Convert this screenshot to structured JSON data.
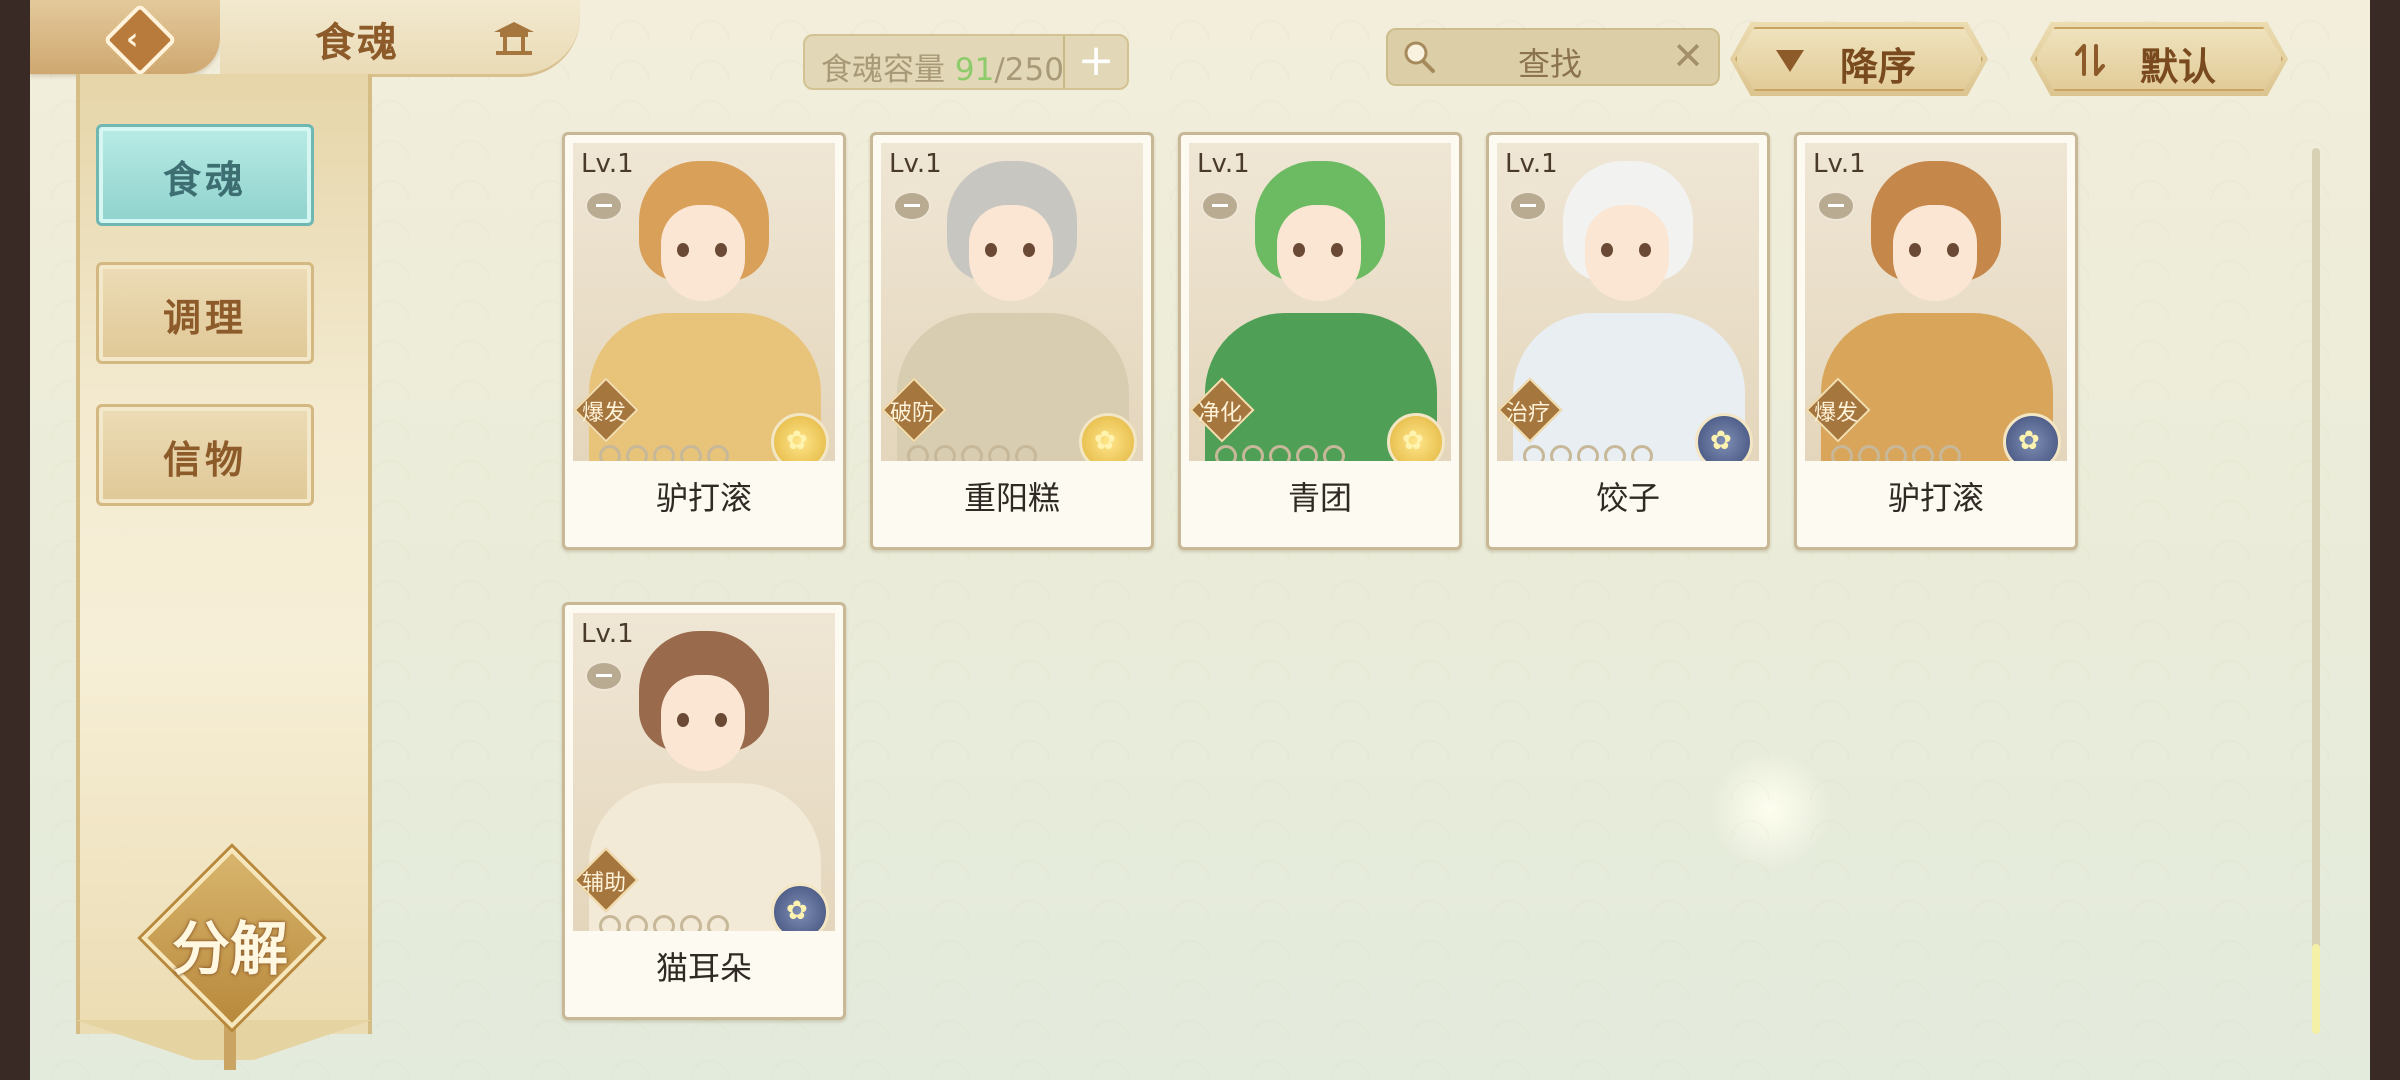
{
  "header": {
    "title": "食魂"
  },
  "capacity": {
    "label": "食魂容量",
    "current": "91",
    "max": "/250",
    "add_label": "+"
  },
  "search": {
    "placeholder": "查找",
    "clear_label": "✕"
  },
  "sort": {
    "order_label": "降序",
    "default_label": "默认"
  },
  "nav": {
    "items": [
      {
        "label": "食魂",
        "active": true
      },
      {
        "label": "调理",
        "active": false
      },
      {
        "label": "信物",
        "active": false
      }
    ],
    "decompose_label": "分解"
  },
  "cards": [
    {
      "level": "Lv.1",
      "name": "驴打滚",
      "skill": "爆发",
      "stars": 0,
      "star_total": 5,
      "rarity": "gold",
      "theme": {
        "hair": "#d9a05a",
        "body": "#e8c37a"
      }
    },
    {
      "level": "Lv.1",
      "name": "重阳糕",
      "skill": "破防",
      "stars": 0,
      "star_total": 5,
      "rarity": "gold",
      "theme": {
        "hair": "#c8c6c0",
        "body": "#d8cdb0"
      }
    },
    {
      "level": "Lv.1",
      "name": "青团",
      "skill": "净化",
      "stars": 0,
      "star_total": 5,
      "rarity": "gold",
      "theme": {
        "hair": "#6cbb63",
        "body": "#4f9f57"
      }
    },
    {
      "level": "Lv.1",
      "name": "饺子",
      "skill": "治疗",
      "stars": 0,
      "star_total": 5,
      "rarity": "blue",
      "theme": {
        "hair": "#f2f2f0",
        "body": "#e9eef2"
      }
    },
    {
      "level": "Lv.1",
      "name": "驴打滚",
      "skill": "爆发",
      "stars": 0,
      "star_total": 5,
      "rarity": "blue",
      "theme": {
        "hair": "#c6874a",
        "body": "#d9a55a"
      }
    },
    {
      "level": "Lv.1",
      "name": "猫耳朵",
      "skill": "辅助",
      "stars": 0,
      "star_total": 5,
      "rarity": "blue",
      "theme": {
        "hair": "#9a6a4c",
        "body": "#f2e9d6"
      }
    }
  ],
  "icons": {
    "back": "back-arrow-icon",
    "home": "pavilion-icon",
    "search": "magnifier-icon",
    "order": "triangle-down-icon",
    "default": "swap-icon",
    "rarity": "flower-icon"
  }
}
